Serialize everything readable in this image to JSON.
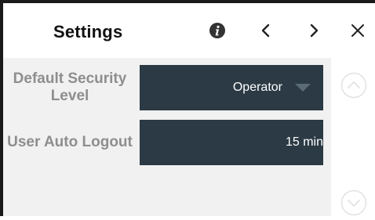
{
  "header": {
    "title": "Settings"
  },
  "settings": [
    {
      "label": "Default Security Level",
      "value": "Operator",
      "control": "dropdown"
    },
    {
      "label": "User Auto Logout",
      "value": "15 min",
      "control": "value-field"
    }
  ],
  "colors": {
    "value_background": "#2b3a44",
    "label_text": "#8e8e8e",
    "panel_background": "#f1f1f1"
  },
  "icons": {
    "info": "info-icon",
    "previous": "chevron-left-icon",
    "next": "chevron-right-icon",
    "close": "close-icon",
    "scroll_up": "scroll-up-icon",
    "scroll_down": "scroll-down-icon",
    "dropdown": "dropdown-arrow-icon"
  }
}
